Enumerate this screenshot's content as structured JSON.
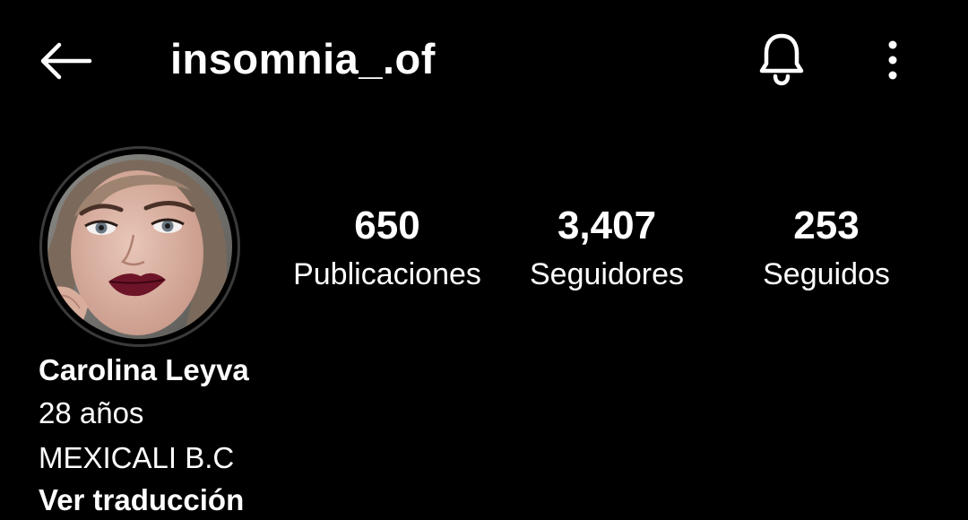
{
  "header": {
    "username": "insomnia_.of",
    "back_icon": "arrow-left-icon",
    "bell_icon": "bell-icon",
    "more_icon": "more-vertical-icon"
  },
  "profile": {
    "avatar_icon": "profile-photo",
    "stats": {
      "posts": {
        "count": "650",
        "label": "Publicaciones"
      },
      "followers": {
        "count": "3,407",
        "label": "Seguidores"
      },
      "following": {
        "count": "253",
        "label": "Seguidos"
      }
    },
    "bio": {
      "name": "Carolina Leyva",
      "lines": [
        "28 años",
        "MEXICALI B.C"
      ],
      "translate_link": "Ver traducción"
    }
  },
  "colors": {
    "background": "#000000",
    "text": "#ffffff",
    "avatar_ring": "#3a3a3a"
  }
}
